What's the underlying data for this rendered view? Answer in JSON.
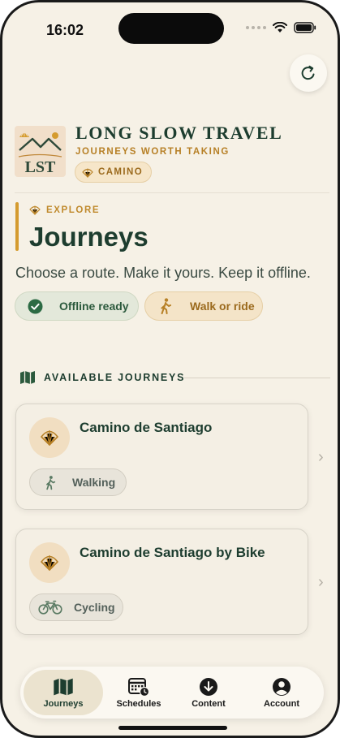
{
  "status": {
    "time": "16:02"
  },
  "brand": {
    "title": "LONG SLOW TRAVEL",
    "tagline": "JOURNEYS WORTH TAKING",
    "chip": "CAMINO",
    "logo_text": "LST"
  },
  "header": {
    "eyebrow": "EXPLORE",
    "title": "Journeys",
    "subtitle": "Choose a route. Make it yours. Keep it offline."
  },
  "pills": {
    "offline": "Offline ready",
    "mode": "Walk or ride"
  },
  "section": {
    "title": "AVAILABLE JOURNEYS"
  },
  "journeys": [
    {
      "title": "Camino de Santiago",
      "mode": "Walking",
      "mode_icon": "walking-icon"
    },
    {
      "title": "Camino de Santiago by Bike",
      "mode": "Cycling",
      "mode_icon": "bicycle-icon"
    }
  ],
  "tabs": [
    {
      "label": "Journeys",
      "icon": "map-icon",
      "active": true
    },
    {
      "label": "Schedules",
      "icon": "calendar-icon",
      "active": false
    },
    {
      "label": "Content",
      "icon": "download-icon",
      "active": false
    },
    {
      "label": "Account",
      "icon": "account-icon",
      "active": false
    }
  ],
  "colors": {
    "background": "#f6f1e6",
    "primary": "#1d3d2f",
    "accent": "#d59b2e",
    "gold_text": "#b78026"
  }
}
